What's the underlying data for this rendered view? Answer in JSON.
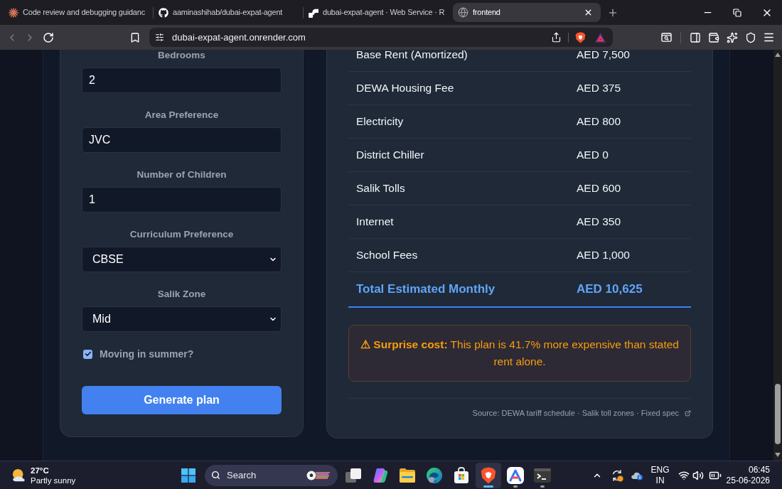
{
  "browser": {
    "tabs": [
      {
        "kind": "sparkle",
        "title": "Code review and debugging guidanc",
        "selected": false
      },
      {
        "kind": "octocat",
        "title": "aaminashihab/dubai-expat-agent",
        "selected": false
      },
      {
        "kind": "blocks",
        "title": "dubai-expat-agent · Web Service · R",
        "selected": false
      },
      {
        "kind": "globe",
        "title": "frontend",
        "selected": true
      }
    ],
    "url": "dubai-expat-agent.onrender.com"
  },
  "form": {
    "fields": [
      {
        "kind": "input",
        "label": "Bedrooms",
        "value": "2"
      },
      {
        "kind": "input",
        "label": "Area Preference",
        "value": "JVC"
      },
      {
        "kind": "input",
        "label": "Number of Children",
        "value": "1"
      },
      {
        "kind": "select",
        "label": "Curriculum Preference",
        "value": "CBSE"
      },
      {
        "kind": "select",
        "label": "Salik Zone",
        "value": "Mid"
      }
    ],
    "summer_checkbox": {
      "label": "Moving in summer?",
      "checked": true
    },
    "submit_button": "Generate plan"
  },
  "cost_breakdown": {
    "rows": [
      {
        "label": "Base Rent (Amortized)",
        "value": "AED 7,500"
      },
      {
        "label": "DEWA Housing Fee",
        "value": "AED 375"
      },
      {
        "label": "Electricity",
        "value": "AED 800"
      },
      {
        "label": "District Chiller",
        "value": "AED 0"
      },
      {
        "label": "Salik Tolls",
        "value": "AED 600"
      },
      {
        "label": "Internet",
        "value": "AED 350"
      },
      {
        "label": "School Fees",
        "value": "AED 1,000"
      }
    ],
    "total": {
      "label": "Total Estimated Monthly",
      "value": "AED 10,625"
    },
    "warning": "**⚠ Surprise cost:** This plan is 41.7% more expensive than stated rent alone.",
    "source": "Source: DEWA tariff schedule · Salik toll zones · Fixed spec"
  },
  "taskbar": {
    "weather": {
      "temperature": "27°C",
      "condition": "Partly sunny"
    },
    "search": "Search",
    "apps": [
      {
        "kind": "task-view",
        "selected": false,
        "running": false
      },
      {
        "kind": "copilot",
        "selected": false,
        "running": false
      },
      {
        "kind": "folder",
        "selected": false,
        "running": false
      },
      {
        "kind": "edge",
        "selected": false,
        "running": false
      },
      {
        "kind": "store",
        "selected": false,
        "running": false
      },
      {
        "kind": "brave",
        "selected": true,
        "running": true
      },
      {
        "kind": "peak",
        "selected": false,
        "running": true
      },
      {
        "kind": "terminal",
        "selected": false,
        "running": true
      }
    ],
    "tray": {
      "language": "ENG",
      "region": "IN",
      "time": "06:45",
      "date": "25-06-2026"
    }
  }
}
